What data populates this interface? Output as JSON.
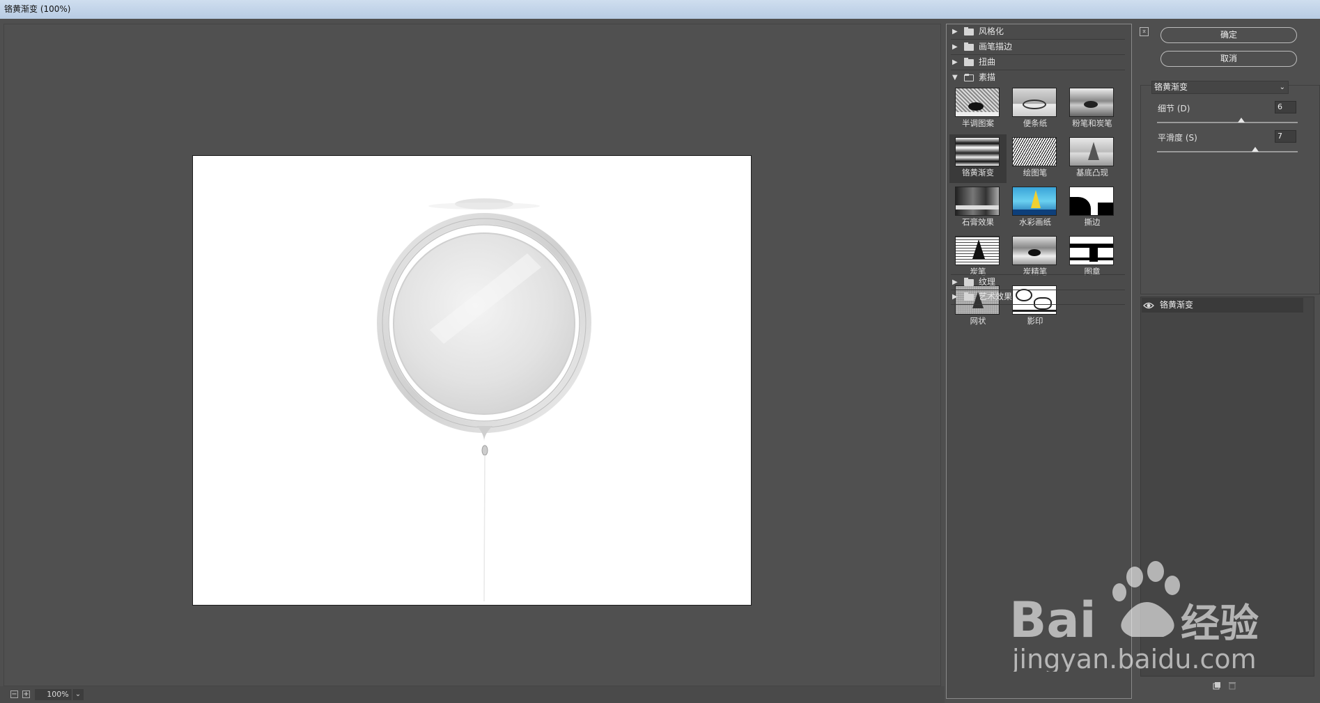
{
  "window": {
    "title": "铬黄渐变 (100%)"
  },
  "zoom": {
    "minus": "−",
    "plus": "+",
    "value": "100%",
    "dropdown": "⌄"
  },
  "gallery": {
    "categories_top": [
      {
        "label": "风格化",
        "expanded": false
      },
      {
        "label": "画笔描边",
        "expanded": false
      },
      {
        "label": "扭曲",
        "expanded": false
      },
      {
        "label": "素描",
        "expanded": true
      }
    ],
    "thumbs": [
      {
        "label": "半调图案"
      },
      {
        "label": "便条纸"
      },
      {
        "label": "粉笔和炭笔"
      },
      {
        "label": "铬黄渐变",
        "selected": true
      },
      {
        "label": "绘图笔"
      },
      {
        "label": "基底凸现"
      },
      {
        "label": "石膏效果"
      },
      {
        "label": "水彩画纸"
      },
      {
        "label": "撕边"
      },
      {
        "label": "炭笔"
      },
      {
        "label": "炭精笔"
      },
      {
        "label": "图章"
      },
      {
        "label": "网状"
      },
      {
        "label": "影印"
      }
    ],
    "categories_bottom": [
      {
        "label": "纹理",
        "expanded": false
      },
      {
        "label": "艺术效果",
        "expanded": false
      }
    ]
  },
  "actions": {
    "collapse_icon": "⌅",
    "ok": "确定",
    "cancel": "取消"
  },
  "settings": {
    "filter": "铬黄渐变",
    "params": [
      {
        "label": "细节 (D)",
        "value": "6",
        "fraction": 0.6
      },
      {
        "label": "平滑度 (S)",
        "value": "7",
        "fraction": 0.7
      }
    ]
  },
  "layers": {
    "items": [
      {
        "name": "铬黄渐变",
        "visible": true
      }
    ]
  },
  "watermark": {
    "brand": "Bai",
    "brand2": "经验",
    "url": "jingyan.baidu.com"
  },
  "colors": {
    "panel": "#4f4f4f",
    "canvas": "#ffffff",
    "titlebar": "#c2d4ea"
  }
}
